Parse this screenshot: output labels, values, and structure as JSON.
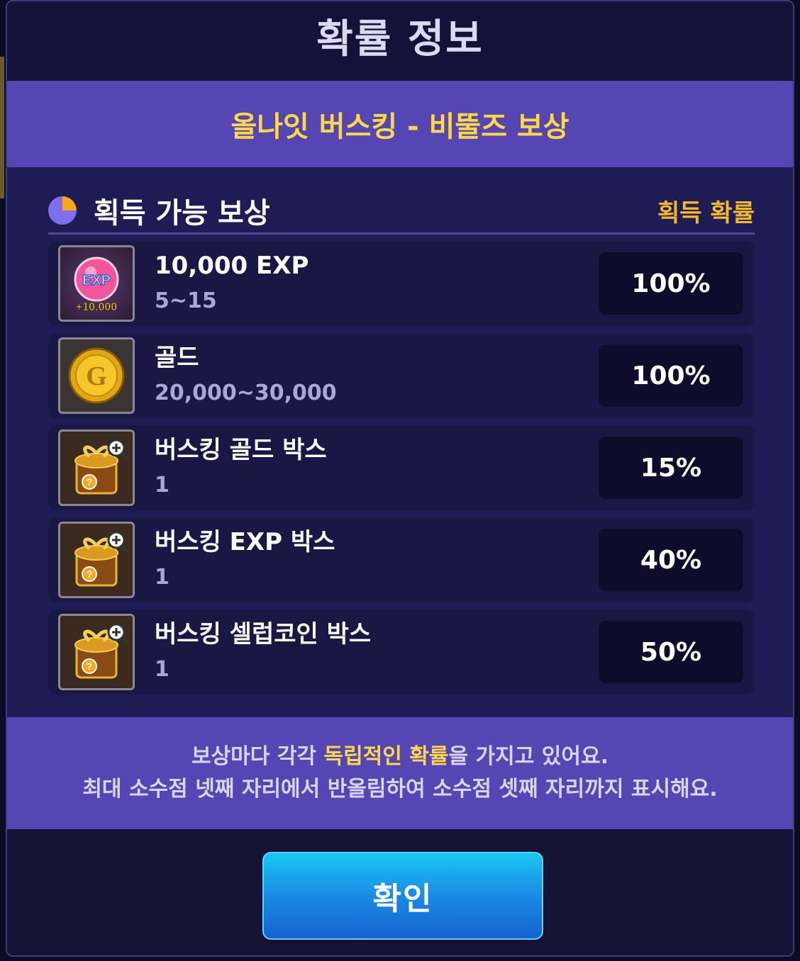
{
  "dialog": {
    "title": "확률 정보",
    "subtitle": "올나잇 버스킹 - 비뚤즈 보상"
  },
  "list": {
    "header_left": "획득 가능 보상",
    "header_right": "획득 확률",
    "items": [
      {
        "name": "10,000 EXP",
        "qty": "5~15",
        "prob": "100%",
        "icon": "exp-orb-icon",
        "icon_text": "EXP",
        "icon_subtext": "+10,000"
      },
      {
        "name": "골드",
        "qty": "20,000~30,000",
        "prob": "100%",
        "icon": "gold-coin-icon",
        "icon_text": "G"
      },
      {
        "name": "버스킹 골드 박스",
        "qty": "1",
        "prob": "15%",
        "icon": "gift-box-icon"
      },
      {
        "name": "버스킹 EXP 박스",
        "qty": "1",
        "prob": "40%",
        "icon": "gift-box-icon"
      },
      {
        "name": "버스킹 셀럽코인 박스",
        "qty": "1",
        "prob": "50%",
        "icon": "gift-box-icon"
      }
    ]
  },
  "info": {
    "line1_pre": "보상마다 각각 ",
    "line1_highlight": "독립적인 확률",
    "line1_post": "을 가지고 있어요.",
    "line2": "최대 소수점 넷째 자리에서 반올림하여 소수점 셋째 자리까지 표시해요."
  },
  "confirm_label": "확인",
  "colors": {
    "accent_yellow": "#ffd84a",
    "header_orange": "#f5b82a",
    "band_purple": "#5646b4",
    "button_blue": "#1a86e2"
  }
}
